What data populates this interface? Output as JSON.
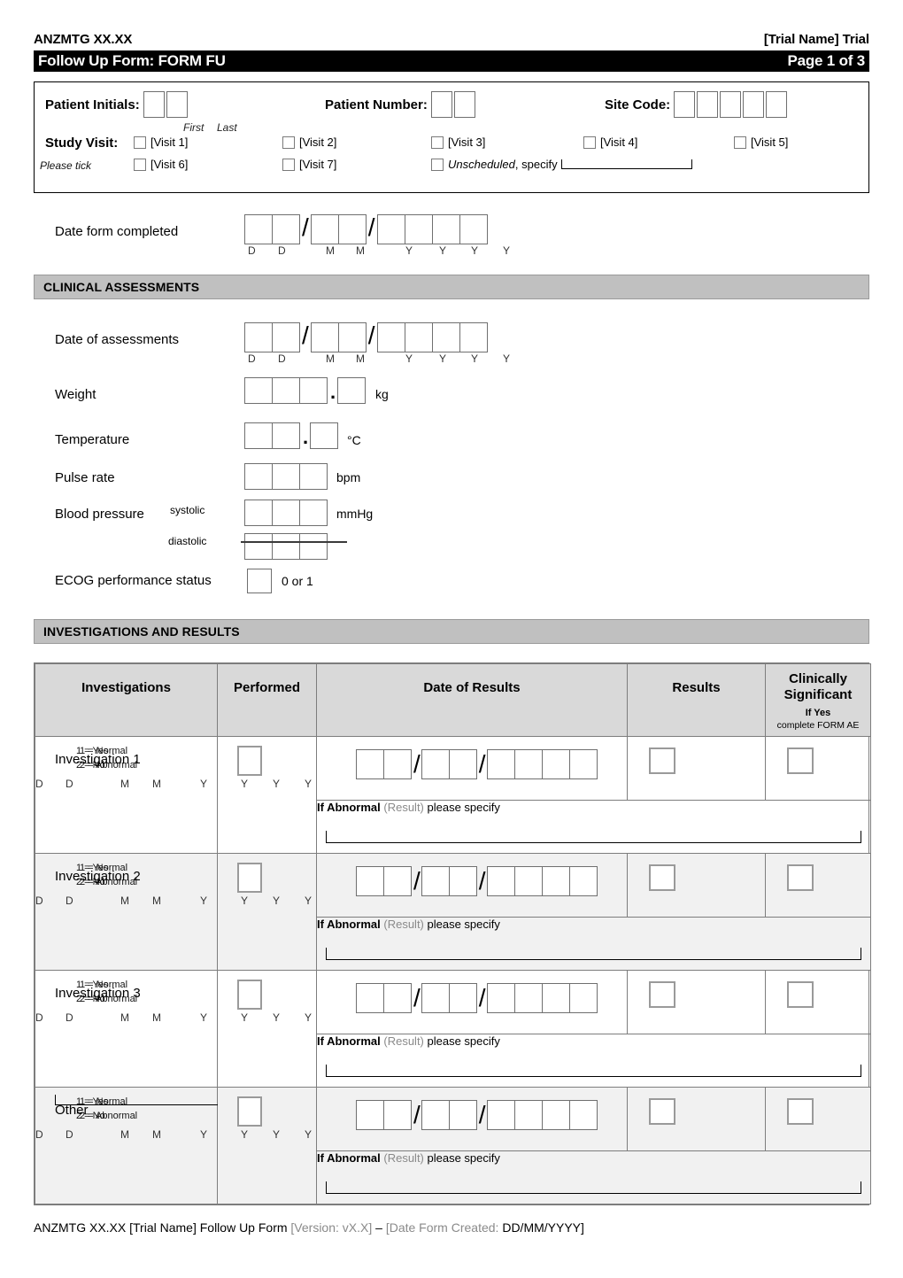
{
  "header": {
    "trial_code": "ANZMTG XX.XX",
    "trial_name": "[Trial Name] Trial",
    "form_title": "Follow Up Form: FORM FU",
    "page_indicator": "Page 1 of 3"
  },
  "patient": {
    "initials_label": "Patient Initials:",
    "first_label": "First",
    "last_label": "Last",
    "number_label": "Patient Number:",
    "site_code_label": "Site Code:",
    "study_visit_label": "Study Visit:",
    "please_tick_label": "Please tick",
    "visits": [
      "[Visit 1]",
      "[Visit 2]",
      "[Visit 3]",
      "[Visit 4]",
      "[Visit 5]",
      "[Visit 6]",
      "[Visit 7]"
    ],
    "unscheduled_italic": "Unscheduled",
    "unscheduled_rest": ", specify"
  },
  "date_form_completed": {
    "label": "Date form completed",
    "d1": "D",
    "d2": "D",
    "m1": "M",
    "m2": "M",
    "y1": "Y",
    "y2": "Y",
    "y3": "Y",
    "y4": "Y"
  },
  "clinical_assessments": {
    "banner": "CLINICAL ASSESSMENTS",
    "date_label": "Date of assessments",
    "weight_label": "Weight",
    "weight_unit": "kg",
    "temperature_label": "Temperature",
    "temperature_unit": "°C",
    "pulse_label": "Pulse rate",
    "pulse_unit": "bpm",
    "bp_label": "Blood pressure",
    "bp_systolic": "systolic",
    "bp_diastolic": "diastolic",
    "bp_unit": "mmHg",
    "ecog_label": "ECOG performance status",
    "ecog_hint": "0 or 1"
  },
  "investigations_section": {
    "banner": "INVESTIGATIONS AND RESULTS",
    "columns": {
      "investigations": "Investigations",
      "performed": "Performed",
      "date_of_results": "Date of Results",
      "results": "Results",
      "clinically_significant": "Clinically Significant",
      "cs_sub_line1": "If Yes",
      "cs_sub_line2": "complete FORM AE"
    },
    "legend": {
      "yes": "1 = Yes",
      "no": "2 = No",
      "normal": "1 = Normal",
      "abnormal": "2 = Abnormal"
    },
    "date_letters": {
      "d1": "D",
      "d2": "D",
      "m1": "M",
      "m2": "M",
      "y": "Y"
    },
    "performed_letters": {
      "y1": "Y",
      "y2": "Y",
      "y3": "Y"
    },
    "specify": {
      "bold": "If Abnormal",
      "gray": "(Result)",
      "plain": "please specify"
    },
    "rows": [
      {
        "name": "Investigation 1",
        "shaded": false,
        "has_other_line": false
      },
      {
        "name": "Investigation 2",
        "shaded": true,
        "has_other_line": false
      },
      {
        "name": "Investigation 3",
        "shaded": false,
        "has_other_line": false
      },
      {
        "name": "Other",
        "shaded": true,
        "has_other_line": true
      }
    ]
  },
  "footer": {
    "part1": "ANZMTG XX.XX [Trial Name] Follow Up Form ",
    "part2_gray": "[Version: vX.X]",
    "part3": " – ",
    "part4_gray": "[Date Form Created: ",
    "part5": "DD/MM/YYYY]"
  },
  "colors": {
    "banner_bg": "#c0c0c0",
    "table_header_bg": "#d9d9d9",
    "row_shade": "#f1f1f1",
    "header_bar_bg": "#000000"
  }
}
